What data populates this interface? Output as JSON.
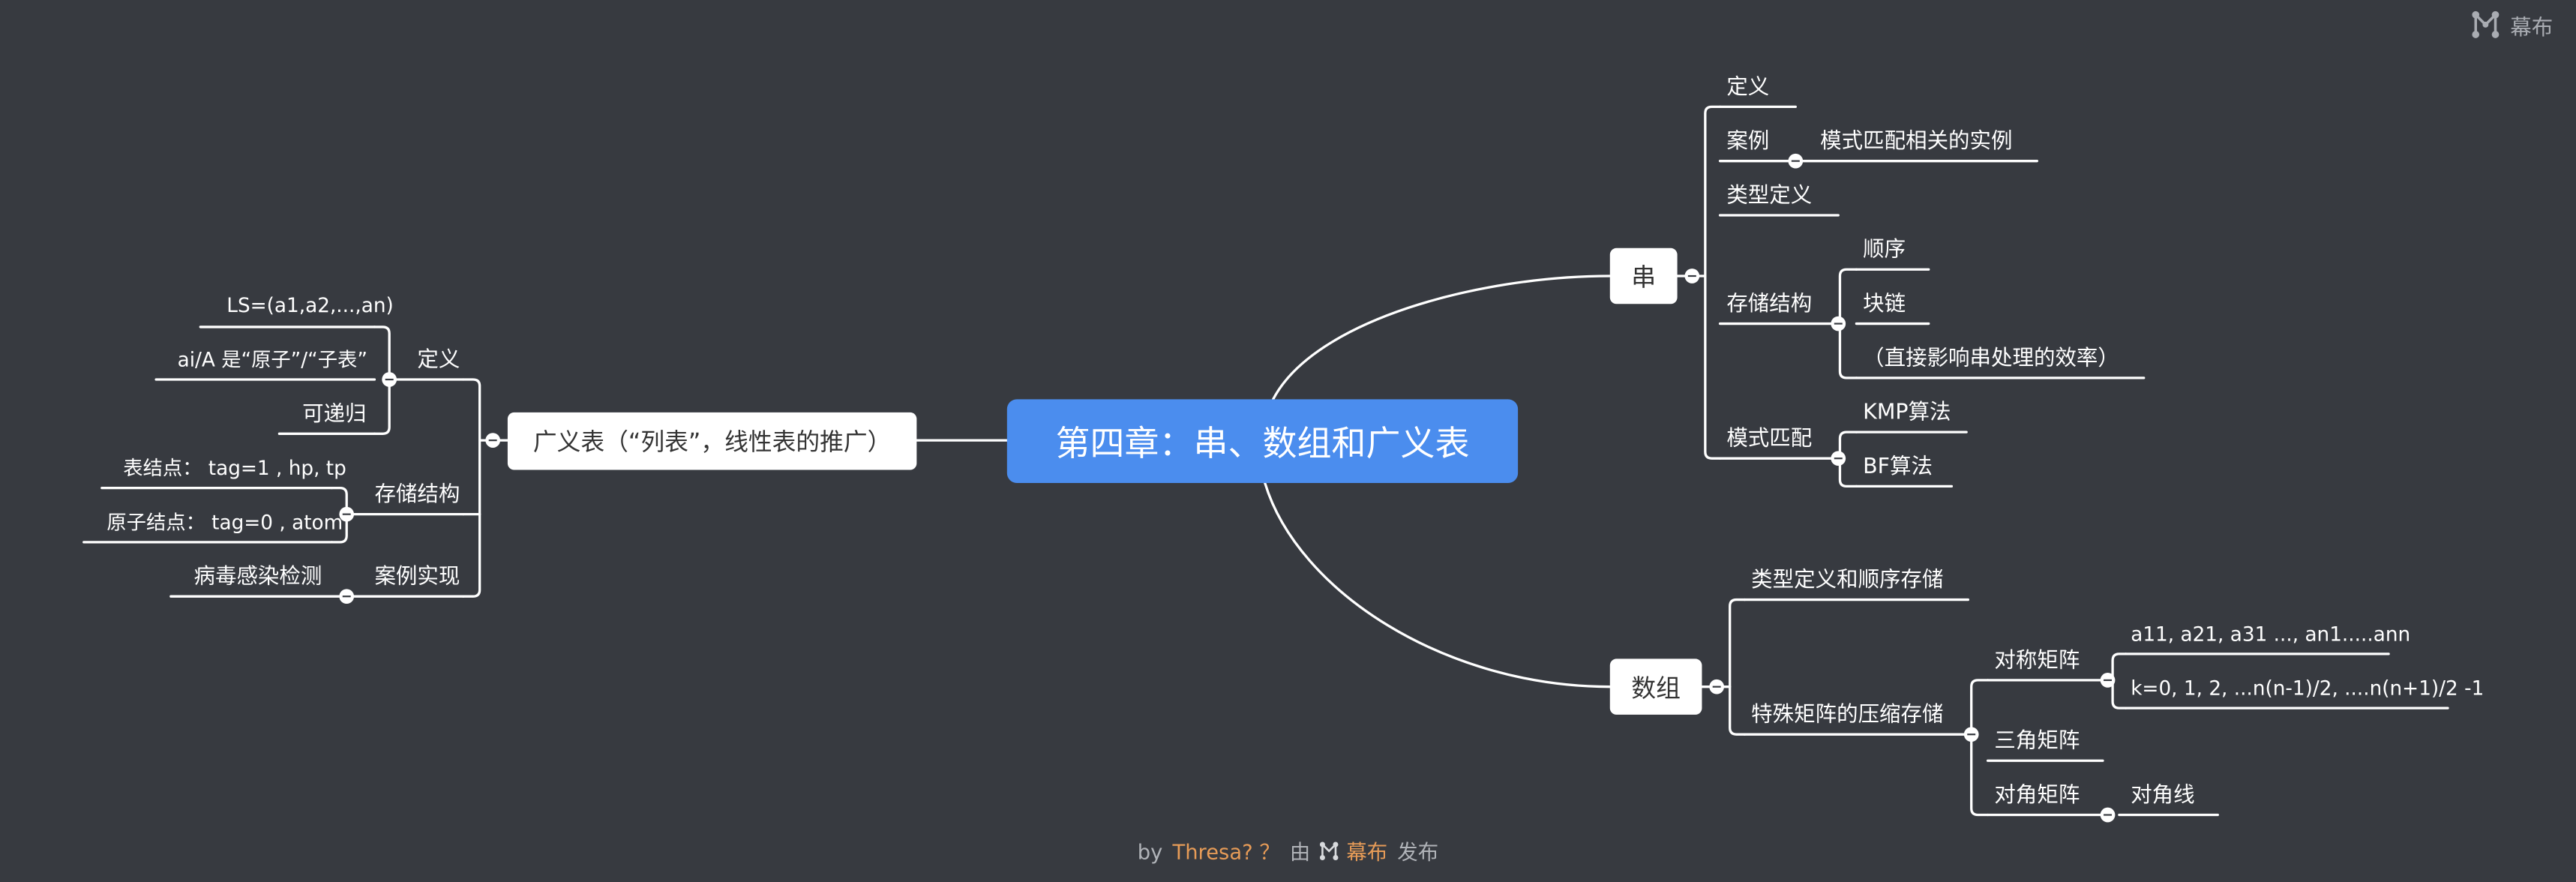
{
  "brand": {
    "name": "幕布",
    "icon": "mubu-logo-icon"
  },
  "footer": {
    "prefix": "by",
    "author": "Thresa? ？",
    "via": "由",
    "platform": "幕布",
    "suffix": "发布"
  },
  "root": {
    "label": "第四章：串、数组和广义表"
  },
  "string_branch": {
    "label": "串",
    "definition": "定义",
    "case": "案例",
    "case_detail": "模式匹配相关的实例",
    "type_def": "类型定义",
    "storage": "存储结构",
    "storage_seq": "顺序",
    "storage_block": "块链",
    "storage_note": "（直接影响串处理的效率）",
    "pattern": "模式匹配",
    "pattern_kmp": "KMP算法",
    "pattern_bf": "BF算法"
  },
  "array_branch": {
    "label": "数组",
    "type_def": "类型定义和顺序存储",
    "special": "特殊矩阵的压缩存储",
    "symmetric": "对称矩阵",
    "symmetric_a": "a11, a21, a31 ..., an1.....ann",
    "symmetric_k": "k=0, 1, 2, ...n(n-1)/2, ....n(n+1)/2 -1",
    "triangular": "三角矩阵",
    "diagonal": "对角矩阵",
    "diagonal_line": "对角线"
  },
  "glist_branch": {
    "label": "广义表（“列表”，线性表的推广）",
    "definition": "定义",
    "def_ls": "LS=(a1,a2,...,an)",
    "def_ai": "ai/A 是“原子”/“子表”",
    "def_recursive": "可递归",
    "storage": "存储结构",
    "storage_table": "表结点： tag=1 , hp, tp",
    "storage_atom": "原子结点： tag=0 , atom",
    "case": "案例实现",
    "case_virus": "病毒感染检测"
  },
  "colors": {
    "background": "#373a40",
    "root": "#4b8dee",
    "line": "#ffffff",
    "accent": "#e69b57"
  }
}
